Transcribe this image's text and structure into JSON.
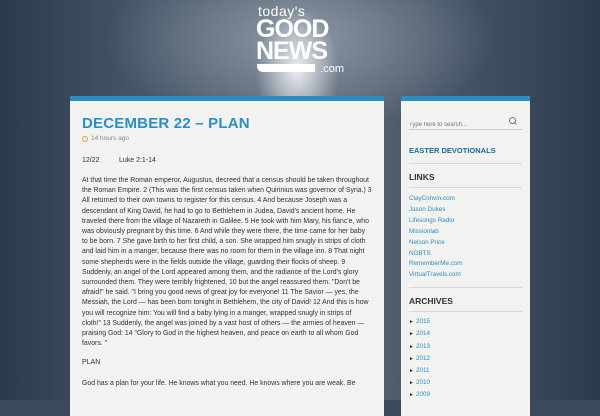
{
  "logo": {
    "line1": "today's",
    "line2": "GOOD",
    "line3": "NEWS",
    "suffix": ".com"
  },
  "post": {
    "title": "DECEMBER 22 – PLAN",
    "time": "14 hours ago",
    "date": "12/22",
    "scripture": "Luke 2:1-14",
    "body": "At that time the Roman emperor, Augustus, decreed that a census should be taken throughout the Roman Empire. 2 (This was the first census taken when Quirinius was governor of Syria.) 3 All returned to their own towns to register for this census. 4 And because Joseph was a descendant of King David, he had to go to Bethlehem in Judea, David's ancient home. He traveled there from the village of Nazareth in Galilee. 5 He took with him Mary, his fianc'e, who was obviously pregnant by this time. 6 And while they were there, the time came for her baby to be born. 7 She gave birth to her first child, a son. She wrapped him snugly in strips of cloth and laid him in a manger, because there was no room for them in the village inn. 8 That night some shepherds were in the fields outside the village, guarding their flocks of sheep. 9 Suddenly, an angel of the Lord appeared among them, and the radiance of the Lord's glory surrounded them. They were terribly frightened, 10 but the angel reassured them. \"Don't be afraid!\" he said. \"I bring you good news of great joy for everyone! 11 The Savior — yes, the Messiah, the Lord — has been born tonight in Bethlehem, the city of David! 12 And this is how you will recognize him: You will find a baby lying in a manger, wrapped snugly in strips of cloth!\" 13 Suddenly, the angel was joined by a vast host of others — the armies of heaven — praising God: 14 \"Glory to God in the highest heaven, and peace on earth to all whom God favors. \"",
    "plan_heading": "PLAN",
    "body2": "God has a plan for your life. He knows what you need. He knows where you are weak. Be"
  },
  "sidebar": {
    "search_placeholder": "Type here to search...",
    "devotionals": "EASTER DEVOTIONALS",
    "links_title": "LINKS",
    "links": [
      "ClayConvin.com",
      "Jason Dukes",
      "Lifesongs Radio",
      "Missionlab",
      "Nelson Price",
      "NOBTS",
      "RememberMe.com",
      "VirtualTravels.com"
    ],
    "archives_title": "ARCHIVES",
    "archives": [
      "2015",
      "2014",
      "2013",
      "2012",
      "2011",
      "2010",
      "2009"
    ]
  },
  "colors": {
    "accent": "#2b8fc6",
    "panel": "#f2f2f0"
  }
}
